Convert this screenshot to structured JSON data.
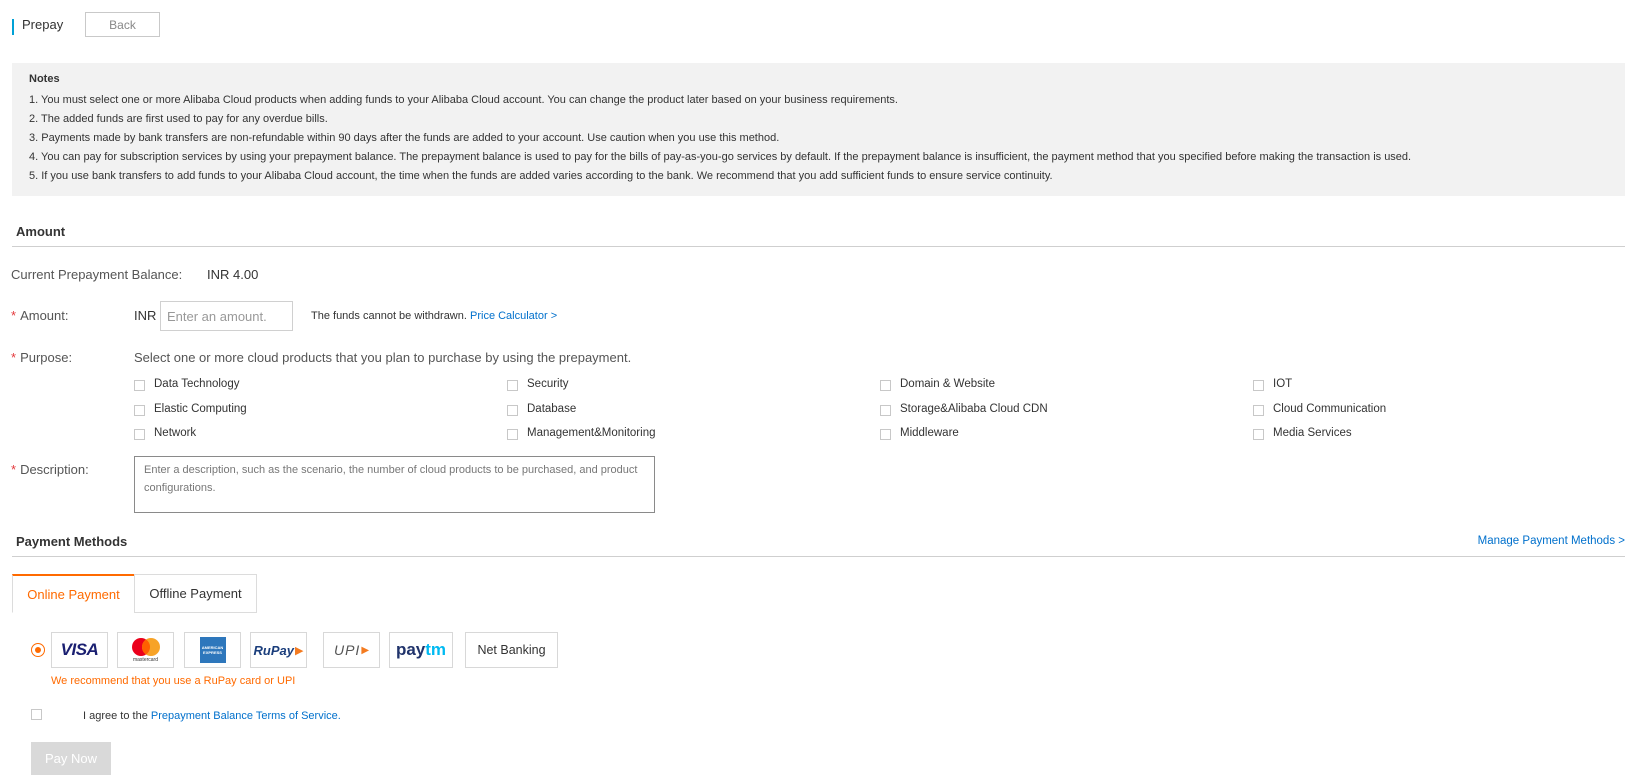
{
  "header": {
    "title": "Prepay",
    "back_label": "Back",
    "accent_color": "#00a1d6"
  },
  "notes": {
    "title": "Notes",
    "items": [
      "1. You must select one or more Alibaba Cloud products when adding funds to your Alibaba Cloud account. You can change the product later based on your business requirements.",
      "2. The added funds are first used to pay for any overdue bills.",
      "3. Payments made by bank transfers are non-refundable within 90 days after the funds are added to your account. Use caution when you use this method.",
      "4. You can pay for subscription services by using your prepayment balance. The prepayment balance is used to pay for the bills of pay-as-you-go services by default. If the prepayment balance is insufficient, the payment method that you specified before making the transaction is used.",
      "5. If you use bank transfers to add funds to your Alibaba Cloud account, the time when the funds are added varies according to the bank. We recommend that you add sufficient funds to ensure service continuity."
    ]
  },
  "amount_section": {
    "title": "Amount",
    "balance_label": "Current Prepayment Balance:",
    "balance_value": "INR 4.00",
    "required_mark": "*",
    "amount_label": "Amount:",
    "currency": "INR",
    "amount_value": "",
    "amount_placeholder": "Enter an amount.",
    "withdraw_note": "The funds cannot be withdrawn.",
    "price_calculator": "Price Calculator >",
    "purpose_label": "Purpose:",
    "purpose_hint": "Select one or more cloud products that you plan to purchase by using the prepayment.",
    "purpose_options": [
      {
        "label": "Data Technology",
        "checked": false
      },
      {
        "label": "Security",
        "checked": false
      },
      {
        "label": "Domain & Website",
        "checked": false
      },
      {
        "label": "IOT",
        "checked": false
      },
      {
        "label": "Elastic Computing",
        "checked": false
      },
      {
        "label": "Database",
        "checked": false
      },
      {
        "label": "Storage&Alibaba Cloud CDN",
        "checked": false
      },
      {
        "label": "Cloud Communication",
        "checked": false
      },
      {
        "label": "Network",
        "checked": false
      },
      {
        "label": "Management&Monitoring",
        "checked": false
      },
      {
        "label": "Middleware",
        "checked": false
      },
      {
        "label": "Media Services",
        "checked": false
      }
    ],
    "description_label": "Description:",
    "description_value": "",
    "description_placeholder": "Enter a description, such as the scenario, the number of cloud products to be purchased, and product configurations."
  },
  "payment_section": {
    "title": "Payment Methods",
    "manage_link": "Manage Payment Methods >",
    "tabs": [
      {
        "label": "Online Payment",
        "active": true
      },
      {
        "label": "Offline Payment",
        "active": false
      }
    ],
    "methods": {
      "visa": "VISA",
      "mastercard": "mastercard",
      "amex_top": "AMERICAN",
      "amex_bottom": "EXPRESS",
      "rupay": "RuPay",
      "upi": "UPI",
      "paytm_a": "pay",
      "paytm_b": "tm",
      "netbanking": "Net Banking"
    },
    "recommend_text": "We recommend that you use a RuPay card or UPI",
    "agree_prefix": "I agree to the",
    "terms_link": "Prepayment Balance Terms of Service.",
    "agree_checked": false,
    "pay_button": "Pay Now",
    "accent_color": "#ff6a00",
    "link_color": "#0070cc"
  }
}
